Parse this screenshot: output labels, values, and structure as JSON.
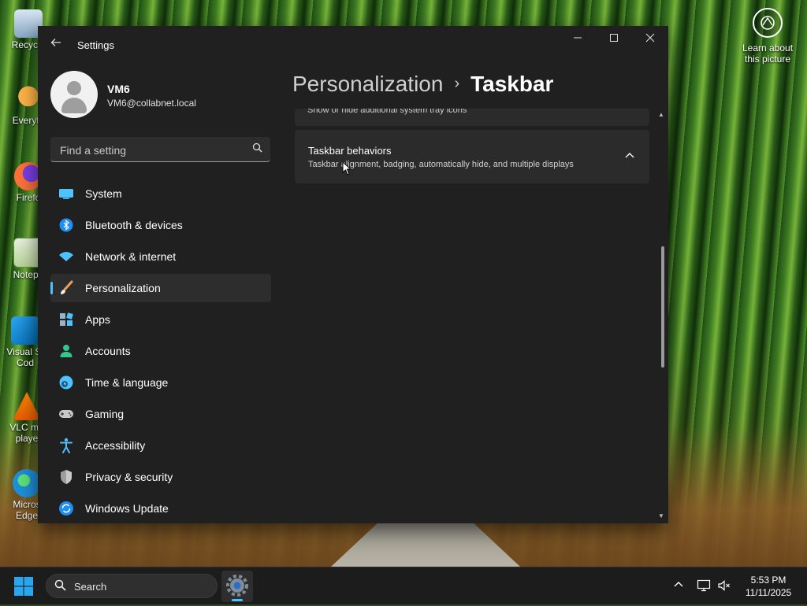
{
  "desktop": {
    "icons": [
      {
        "label": "Recycle",
        "icon": "recycle-bin-icon"
      },
      {
        "label": "Everyth",
        "icon": "everything-search-icon"
      },
      {
        "label": "Firefo",
        "icon": "firefox-icon"
      },
      {
        "label": "Notepa",
        "icon": "notepad-icon"
      },
      {
        "label": "Visual St Cod",
        "icon": "vscode-icon"
      },
      {
        "label": "VLC me playe",
        "icon": "vlc-icon"
      },
      {
        "label": "Micros Edge",
        "icon": "edge-icon"
      }
    ],
    "learn_about": "Learn about this picture"
  },
  "window": {
    "title": "Settings",
    "controls": {
      "minimize": "minimize",
      "maximize": "maximize",
      "close": "close"
    }
  },
  "profile": {
    "name": "VM6",
    "email": "VM6@collabnet.local"
  },
  "search": {
    "placeholder": "Find a setting"
  },
  "nav": {
    "items": [
      {
        "label": "System",
        "icon": "system-icon"
      },
      {
        "label": "Bluetooth & devices",
        "icon": "bluetooth-icon"
      },
      {
        "label": "Network & internet",
        "icon": "wifi-icon"
      },
      {
        "label": "Personalization",
        "icon": "brush-icon",
        "active": true
      },
      {
        "label": "Apps",
        "icon": "apps-icon"
      },
      {
        "label": "Accounts",
        "icon": "accounts-icon"
      },
      {
        "label": "Time & language",
        "icon": "globe-clock-icon"
      },
      {
        "label": "Gaming",
        "icon": "gamepad-icon"
      },
      {
        "label": "Accessibility",
        "icon": "accessibility-icon"
      },
      {
        "label": "Privacy & security",
        "icon": "shield-icon"
      },
      {
        "label": "Windows Update",
        "icon": "update-icon"
      }
    ]
  },
  "breadcrumb": {
    "parent": "Personalization",
    "separator": "›",
    "current": "Taskbar"
  },
  "cards": {
    "partial_desc": "Show or hide additional system tray icons",
    "taskbar_behaviors": {
      "title": "Taskbar behaviors",
      "desc": "Taskbar alignment, badging, automatically hide, and multiple displays",
      "expanded": true
    }
  },
  "taskbar": {
    "search_label": "Search",
    "clock_time": "5:53 PM",
    "clock_date": "11/11/2025"
  },
  "colors": {
    "accent": "#4cc2ff",
    "window_bg": "#202020",
    "card_bg": "#2b2b2b",
    "taskbar_bg": "#1c1c1c"
  }
}
